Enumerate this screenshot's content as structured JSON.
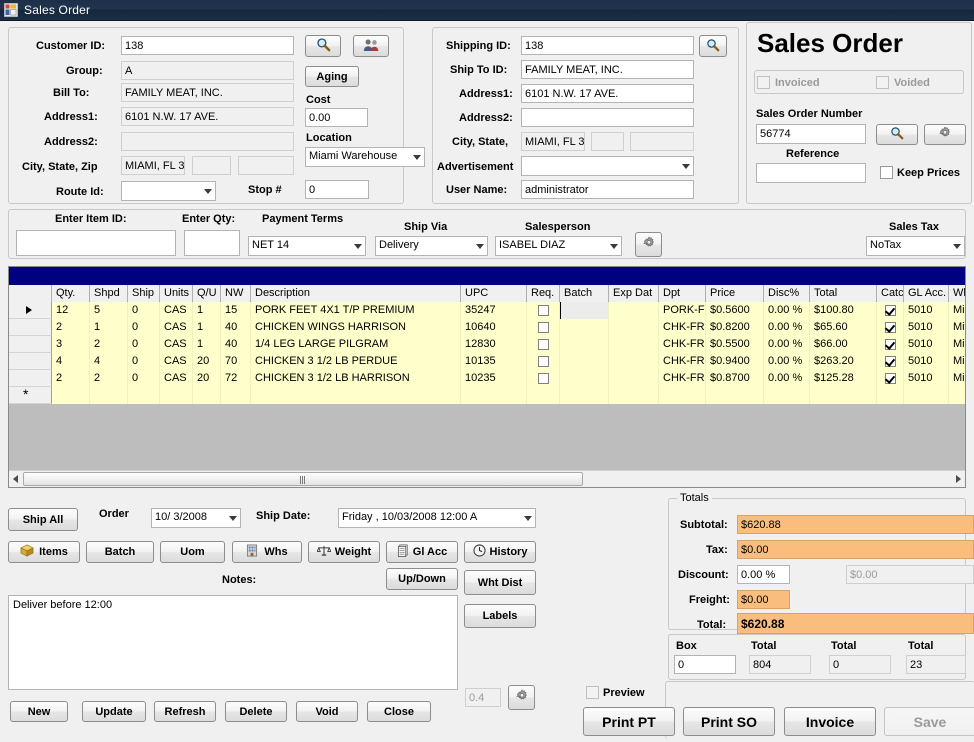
{
  "window": {
    "title": "Sales Order",
    "icon": "app-icon"
  },
  "customer": {
    "labels": {
      "customer_id": "Customer ID:",
      "group": "Group:",
      "bill_to": "Bill To:",
      "address1": "Address1:",
      "address2": "Address2:",
      "city_state_zip": "City, State, Zip",
      "route_id": "Route Id:",
      "stop": "Stop #"
    },
    "values": {
      "customer_id": "138",
      "group": "A",
      "bill_to": "FAMILY MEAT, INC.",
      "address1": "6101 N.W. 17 AVE.",
      "address2": "",
      "city": "MIAMI, FL 3",
      "state": "",
      "zip": "",
      "route_id": "",
      "stop": "0"
    },
    "buttons": {
      "search": "search-icon",
      "customers": "people-icon",
      "aging": "Aging"
    },
    "cost_label": "Cost",
    "cost_value": "0.00",
    "location_label": "Location",
    "location_value": "Miami Warehouse"
  },
  "shipping": {
    "labels": {
      "shipping_id": "Shipping ID:",
      "ship_to_id": "Ship To ID:",
      "address1": "Address1:",
      "address2": "Address2:",
      "city_state": "City, State,",
      "advertisement": "Advertisement",
      "user_name": "User Name:"
    },
    "values": {
      "shipping_id": "138",
      "ship_to_id": "FAMILY MEAT, INC.",
      "address1": "6101 N.W. 17 AVE.",
      "address2": "",
      "city": "MIAMI, FL 3",
      "state": "",
      "zip": "",
      "advertisement": "",
      "user_name": "administrator"
    },
    "search_button": "search-icon"
  },
  "order_panel": {
    "title": "Sales Order",
    "invoiced_label": "Invoiced",
    "invoiced_checked": false,
    "voided_label": "Voided",
    "voided_checked": false,
    "so_number_label": "Sales Order Number",
    "so_number": "56774",
    "reference_label": "Reference",
    "reference": "",
    "keep_prices_label": "Keep Prices",
    "keep_prices_checked": false,
    "search_button": "search-icon",
    "settings_button": "gear-icon"
  },
  "entrybar": {
    "enter_item_id_label": "Enter Item ID:",
    "enter_item_id": "",
    "enter_qty_label": "Enter Qty:",
    "enter_qty": "",
    "payment_terms_label": "Payment Terms",
    "payment_terms": "NET 14",
    "ship_via_label": "Ship Via",
    "ship_via": "Delivery",
    "salesperson_label": "Salesperson",
    "salesperson": "ISABEL DIAZ",
    "salesperson_settings": "gear-icon",
    "sales_tax_label": "Sales Tax",
    "sales_tax": "NoTax"
  },
  "grid": {
    "columns": [
      "Qty.",
      "Shpd",
      "Ship",
      "Units",
      "Q/U",
      "NW",
      "Description",
      "UPC",
      "Req.",
      "Batch",
      "Exp Dat",
      "Dpt",
      "Price",
      "Disc%",
      "Total",
      "Catc",
      "GL Acc.",
      "Wh"
    ],
    "rows": [
      {
        "selected": true,
        "qty": "12",
        "shpd": "5",
        "ship": "0",
        "units": "CAS",
        "qu": "1",
        "nw": "15",
        "description": "PORK FEET 4X1 T/P PREMIUM",
        "upc": "35247",
        "req": false,
        "batch": "",
        "exp_dat": "",
        "dpt": "PORK-F",
        "price": "$0.5600",
        "disc": "0.00 %",
        "total": "$100.80",
        "catc": true,
        "gl_acc": "5010",
        "wh": "Mia"
      },
      {
        "selected": false,
        "qty": "2",
        "shpd": "1",
        "ship": "0",
        "units": "CAS",
        "qu": "1",
        "nw": "40",
        "description": "CHICKEN WINGS HARRISON",
        "upc": "10640",
        "req": false,
        "batch": "",
        "exp_dat": "",
        "dpt": "CHK-FR",
        "price": "$0.8200",
        "disc": "0.00 %",
        "total": "$65.60",
        "catc": true,
        "gl_acc": "5010",
        "wh": "Mia"
      },
      {
        "selected": false,
        "qty": "3",
        "shpd": "2",
        "ship": "0",
        "units": "CAS",
        "qu": "1",
        "nw": "40",
        "description": "1/4 LEG  LARGE PILGRAM",
        "upc": "12830",
        "req": false,
        "batch": "",
        "exp_dat": "",
        "dpt": "CHK-FR",
        "price": "$0.5500",
        "disc": "0.00 %",
        "total": "$66.00",
        "catc": true,
        "gl_acc": "5010",
        "wh": "Mia"
      },
      {
        "selected": false,
        "qty": "4",
        "shpd": "4",
        "ship": "0",
        "units": "CAS",
        "qu": "20",
        "nw": "70",
        "description": "CHICKEN 3 1/2 LB PERDUE",
        "upc": "10135",
        "req": false,
        "batch": "",
        "exp_dat": "",
        "dpt": "CHK-FR",
        "price": "$0.9400",
        "disc": "0.00 %",
        "total": "$263.20",
        "catc": true,
        "gl_acc": "5010",
        "wh": "Mia"
      },
      {
        "selected": false,
        "qty": "2",
        "shpd": "2",
        "ship": "0",
        "units": "CAS",
        "qu": "20",
        "nw": "72",
        "description": "CHICKEN 3 1/2 LB HARRISON",
        "upc": "10235",
        "req": false,
        "batch": "",
        "exp_dat": "",
        "dpt": "CHK-FR",
        "price": "$0.8700",
        "disc": "0.00 %",
        "total": "$125.28",
        "catc": true,
        "gl_acc": "5010",
        "wh": "Mia"
      }
    ],
    "new_row_marker": "*"
  },
  "bottom": {
    "ship_all": "Ship All",
    "order_label": "Order",
    "order_date": "10/  3/2008",
    "ship_date_label": "Ship Date:",
    "ship_date": "Friday      , 10/03/2008 12:00 A",
    "buttons": [
      {
        "name": "items",
        "label": "Items",
        "icon": "box-icon"
      },
      {
        "name": "batch",
        "label": "Batch",
        "icon": ""
      },
      {
        "name": "uom",
        "label": "Uom",
        "icon": ""
      },
      {
        "name": "whs",
        "label": "Whs",
        "icon": "building-icon"
      },
      {
        "name": "weight",
        "label": "Weight",
        "icon": "scale-icon"
      },
      {
        "name": "gl-acc",
        "label": "Gl Acc",
        "icon": "ledger-icon"
      },
      {
        "name": "history",
        "label": "History",
        "icon": "clock-icon"
      }
    ],
    "notes_label": "Notes:",
    "notes_value": "Deliver before 12:00",
    "up_down": "Up/Down",
    "wht_dist": "Wht Dist",
    "labels_btn": "Labels",
    "action_buttons": [
      "New",
      "Update",
      "Refresh",
      "Delete",
      "Void",
      "Close"
    ],
    "small_value": "0.4",
    "small_settings": "gear-icon"
  },
  "totals": {
    "caption": "Totals",
    "rows": [
      {
        "label": "Subtotal:",
        "value": "$620.88",
        "style": "orange"
      },
      {
        "label": "Tax:",
        "value": "$0.00",
        "style": "orange"
      },
      {
        "label": "Discount:",
        "value": "0.00 %",
        "style": "white",
        "secondary": "$0.00"
      },
      {
        "label": "Freight:",
        "value": "$0.00",
        "style": "orange-short"
      },
      {
        "label": "Total:",
        "value": "$620.88",
        "style": "orange-bold"
      }
    ],
    "counters": [
      {
        "label": "Box",
        "value": "0",
        "editable": true
      },
      {
        "label": "Total",
        "value": "804",
        "editable": false
      },
      {
        "label": "Total",
        "value": "0",
        "editable": false
      },
      {
        "label": "Total",
        "value": "23",
        "editable": false
      }
    ]
  },
  "footer": {
    "preview_label": "Preview",
    "preview_checked": false,
    "print_pt": "Print PT",
    "print_so": "Print SO",
    "invoice": "Invoice",
    "save": "Save",
    "save_disabled": true
  },
  "colors": {
    "title_bar": "#1d3048",
    "grid_header_bar": "#000080",
    "row_bg": "#ffffcc",
    "totals_highlight": "#f9bd7e",
    "form_bg": "#f0f0f0"
  }
}
